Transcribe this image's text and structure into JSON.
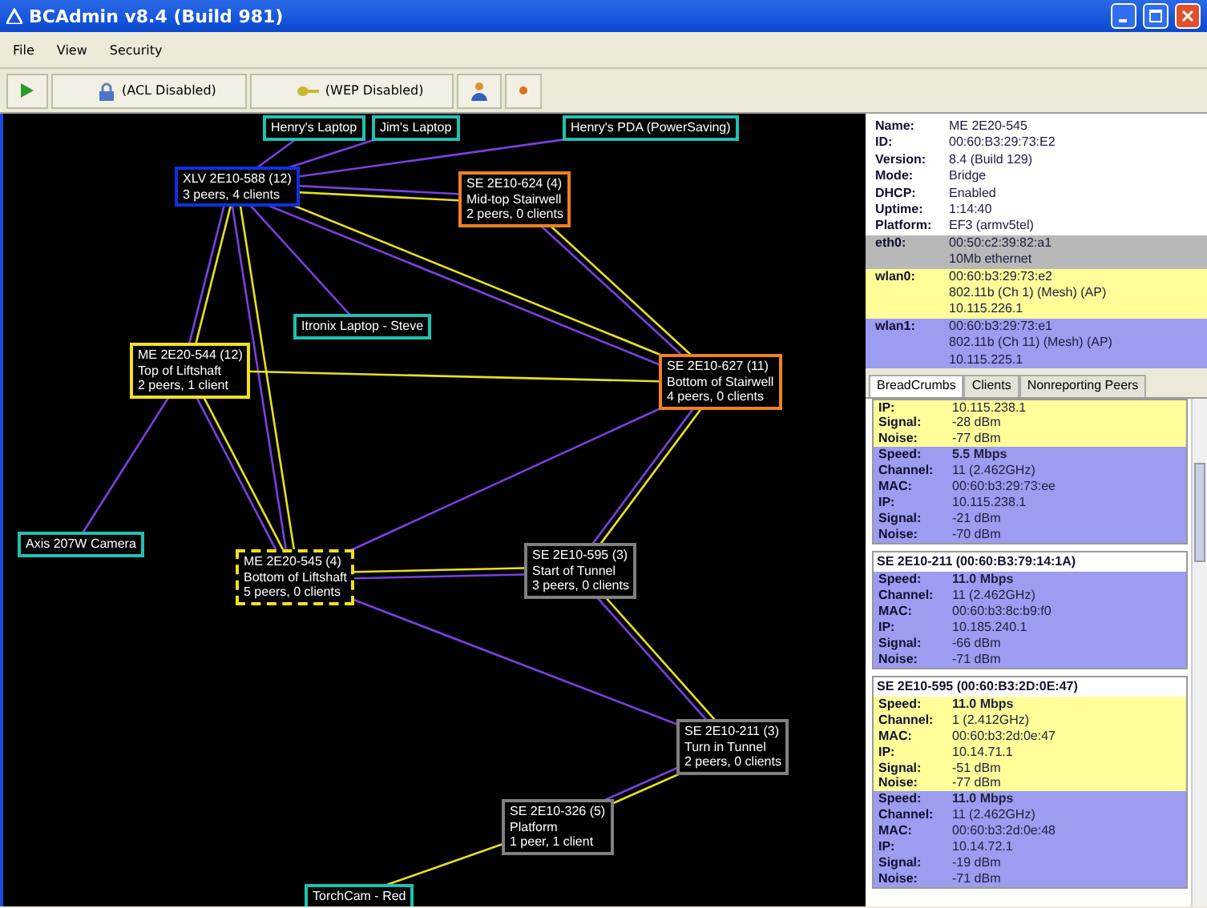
{
  "window": {
    "title": "BCAdmin v8.4 (Build 981)"
  },
  "menu": [
    "File",
    "View",
    "Security"
  ],
  "toolbar": [
    {
      "kind": "play"
    },
    {
      "kind": "lock",
      "label": "(ACL Disabled)"
    },
    {
      "kind": "key",
      "label": "(WEP Disabled)"
    },
    {
      "kind": "person"
    },
    {
      "kind": "dot"
    }
  ],
  "nodes": [
    {
      "lines": [
        "Henry's Laptop"
      ],
      "color": "#20c0b0",
      "selected": false
    },
    {
      "lines": [
        "Jim's Laptop"
      ],
      "color": "#20c0b0",
      "selected": false
    },
    {
      "lines": [
        "Henry's PDA (PowerSaving)"
      ],
      "color": "#20c0b0",
      "selected": false
    },
    {
      "lines": [
        "Itronix Laptop - Steve"
      ],
      "color": "#20c0b0",
      "selected": false
    },
    {
      "lines": [
        "Axis 207W Camera"
      ],
      "color": "#20c0b0",
      "selected": false
    },
    {
      "lines": [
        "TorchCam - Red"
      ],
      "color": "#20c0b0",
      "selected": false
    },
    {
      "lines": [
        "XLV 2E10-588 (12)",
        "3 peers, 4 clients"
      ],
      "color": "#1030e0",
      "selected": false
    },
    {
      "lines": [
        "SE 2E10-624 (4)",
        "Mid-top Stairwell",
        "2 peers, 0 clients"
      ],
      "color": "#f08020",
      "selected": false
    },
    {
      "lines": [
        "ME 2E20-544 (12)",
        "Top of Liftshaft",
        "2 peers, 1 client"
      ],
      "color": "#f0e020",
      "selected": false
    },
    {
      "lines": [
        "SE 2E10-627 (11)",
        "Bottom of Stairwell",
        "4 peers, 0 clients"
      ],
      "color": "#f08020",
      "selected": false
    },
    {
      "lines": [
        "ME 2E20-545 (4)",
        "Bottom of Liftshaft",
        "5 peers, 0 clients"
      ],
      "color": "#f0e020",
      "selected": true
    },
    {
      "lines": [
        "SE 2E10-595 (3)",
        "Start of Tunnel",
        "3 peers, 0 clients"
      ],
      "color": "#808080",
      "selected": false
    },
    {
      "lines": [
        "SE 2E10-211 (3)",
        "Turn in Tunnel",
        "2 peers, 0 clients"
      ],
      "color": "#808080",
      "selected": false
    },
    {
      "lines": [
        "SE 2E10-326 (5)",
        "Platform",
        "1 peer, 1 client"
      ],
      "color": "#808080",
      "selected": false
    }
  ],
  "properties": [
    {
      "label": "Name:",
      "value": "ME 2E20-545"
    },
    {
      "label": "ID:",
      "value": "00:60:B3:29:73:E2"
    },
    {
      "label": "Version:",
      "value": "8.4 (Build 129)"
    },
    {
      "label": "Mode:",
      "value": "Bridge"
    },
    {
      "label": "DHCP:",
      "value": "Enabled"
    },
    {
      "label": "Uptime:",
      "value": "1:14:40"
    },
    {
      "label": "Platform:",
      "value": "EF3 (armv5tel)"
    }
  ],
  "interfaces": [
    {
      "label": "eth0:",
      "color": "#b8b8b8",
      "lines": [
        "00:50:c2:39:82:a1",
        "10Mb ethernet"
      ]
    },
    {
      "label": "wlan0:",
      "color": "#fffe98",
      "lines": [
        "00:60:b3:29:73:e2",
        "802.11b (Ch 1) (Mesh) (AP)",
        "10.115.226.1"
      ]
    },
    {
      "label": "wlan1:",
      "color": "#9c9cf0",
      "lines": [
        "00:60:b3:29:73:e1",
        "802.11b (Ch 11) (Mesh) (AP)",
        "10.115.225.1"
      ]
    }
  ],
  "tabs": [
    {
      "label": "BreadCrumbs",
      "selected": true
    },
    {
      "label": "Clients",
      "selected": false
    },
    {
      "label": "Nonreporting Peers",
      "selected": false
    }
  ],
  "breadcrumbs": [
    {
      "sections": [
        {
          "color": "#fffe98",
          "rows": [
            {
              "label": "IP:",
              "value": "10.115.238.1"
            },
            {
              "label": "Signal:",
              "value": "-28 dBm"
            },
            {
              "label": "Noise:",
              "value": "-77 dBm"
            }
          ]
        },
        {
          "color": "#9c9cf0",
          "rows": [
            {
              "label": "Speed:",
              "value": "5.5 Mbps"
            },
            {
              "label": "Channel:",
              "value": "11 (2.462GHz)"
            },
            {
              "label": "MAC:",
              "value": "00:60:b3:29:73:ee"
            },
            {
              "label": "IP:",
              "value": "10.115.238.1"
            },
            {
              "label": "Signal:",
              "value": "-21 dBm"
            },
            {
              "label": "Noise:",
              "value": "-70 dBm"
            }
          ]
        }
      ]
    },
    {
      "header": "SE 2E10-211 (00:60:B3:79:14:1A)",
      "sections": [
        {
          "color": "#9c9cf0",
          "rows": [
            {
              "label": "Speed:",
              "value": "11.0 Mbps"
            },
            {
              "label": "Channel:",
              "value": "11 (2.462GHz)"
            },
            {
              "label": "MAC:",
              "value": "00:60:b3:8c:b9:f0"
            },
            {
              "label": "IP:",
              "value": "10.185.240.1"
            },
            {
              "label": "Signal:",
              "value": "-66 dBm"
            },
            {
              "label": "Noise:",
              "value": "-71 dBm"
            }
          ]
        }
      ]
    },
    {
      "header": "SE 2E10-595 (00:60:B3:2D:0E:47)",
      "sections": [
        {
          "color": "#fffe98",
          "rows": [
            {
              "label": "Speed:",
              "value": "11.0 Mbps"
            },
            {
              "label": "Channel:",
              "value": "1 (2.412GHz)"
            },
            {
              "label": "MAC:",
              "value": "00:60:b3:2d:0e:47"
            },
            {
              "label": "IP:",
              "value": "10.14.71.1"
            },
            {
              "label": "Signal:",
              "value": "-51 dBm"
            },
            {
              "label": "Noise:",
              "value": "-77 dBm"
            }
          ]
        },
        {
          "color": "#9c9cf0",
          "rows": [
            {
              "label": "Speed:",
              "value": "11.0 Mbps"
            },
            {
              "label": "Channel:",
              "value": "11 (2.462GHz)"
            },
            {
              "label": "MAC:",
              "value": "00:60:b3:2d:0e:48"
            },
            {
              "label": "IP:",
              "value": "10.14.72.1"
            },
            {
              "label": "Signal:",
              "value": "-19 dBm"
            },
            {
              "label": "Noise:",
              "value": "-71 dBm"
            }
          ]
        }
      ]
    }
  ]
}
